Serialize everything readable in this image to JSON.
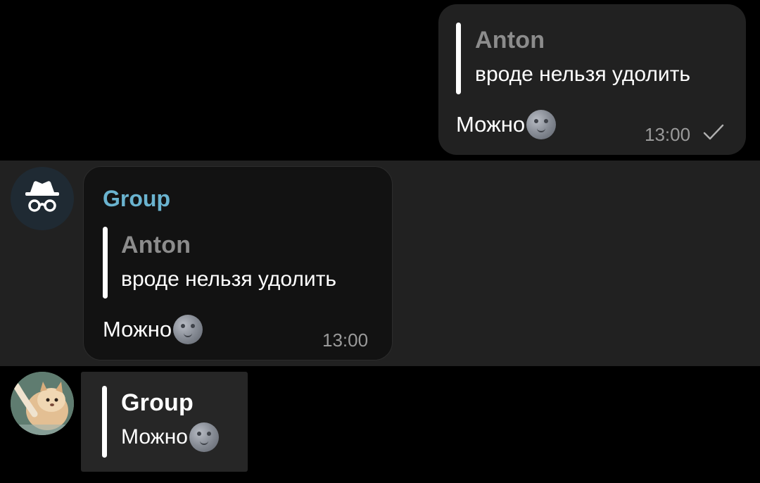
{
  "messages": [
    {
      "direction": "outgoing",
      "quote": {
        "name": "Anton",
        "text": "вроде нельзя удолить"
      },
      "text": "Можно",
      "emoji": "new-moon-face",
      "time": "13:00",
      "status": "sent-check-icon"
    },
    {
      "direction": "incoming",
      "sender": "Group",
      "avatar": "incognito-icon",
      "quote": {
        "name": "Anton",
        "text": "вроде нельзя удолить"
      },
      "text": "Можно",
      "emoji": "new-moon-face",
      "time": "13:00"
    },
    {
      "direction": "incoming",
      "avatar": "cat-photo",
      "quote": {
        "name": "Group",
        "text": "Можно"
      },
      "emoji": "new-moon-face"
    }
  ],
  "colors": {
    "background": "#000000",
    "bubble": "#212121",
    "sender_name": "#6ab3cf",
    "quote_name": "#8c8c8c",
    "time": "#9a9a9a"
  }
}
